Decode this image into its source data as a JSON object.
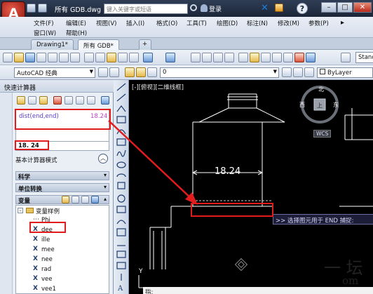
{
  "titlebar": {
    "app_logo": "A",
    "document_title": "所有 GDB.dwg",
    "search_placeholder": "键入关键字或短语",
    "login_label": "登录",
    "help_label": "?",
    "minimize": "–",
    "restore": "□",
    "close": "✕"
  },
  "menubar": {
    "items": [
      "文件(F)",
      "编辑(E)",
      "视图(V)",
      "插入(I)",
      "格式(O)",
      "工具(T)",
      "绘图(D)",
      "标注(N)",
      "修改(M)",
      "参数(P)"
    ],
    "items_row2": [
      "窗口(W)",
      "帮助(H)"
    ]
  },
  "tabs": [
    {
      "label": "Drawing1*"
    },
    {
      "label": "所有 GDB*"
    }
  ],
  "toolbar": {
    "workspace": "AutoCAD 经典",
    "layer_value": "0",
    "bylayer": "ByLayer",
    "standard": "Stand"
  },
  "palette": {
    "title": "快速计算器",
    "history_expression": "dist(end,end)",
    "history_result": "18.24",
    "input_value": "18. 24",
    "mode_label": "基本计算器模式",
    "sections": [
      "科学",
      "单位转换",
      "变量"
    ],
    "tree_root": "变量样例",
    "variables": [
      "Phi",
      "dee",
      "ille",
      "mee",
      "nee",
      "rad",
      "vee",
      "vee1"
    ]
  },
  "canvas": {
    "view_label": "[-][俯视][二维线框]",
    "dimension_value": "18.24",
    "tooltip": ">> 选择图元用于 END 捕捉:",
    "command_prompt": "指:",
    "compass_n": "北",
    "compass_w": "西",
    "compass_e": "东",
    "compass_center": "上",
    "wcs": "WCS",
    "y_axis": "Y"
  },
  "watermark": {
    "line1": "一 坛",
    "line2": "om"
  }
}
